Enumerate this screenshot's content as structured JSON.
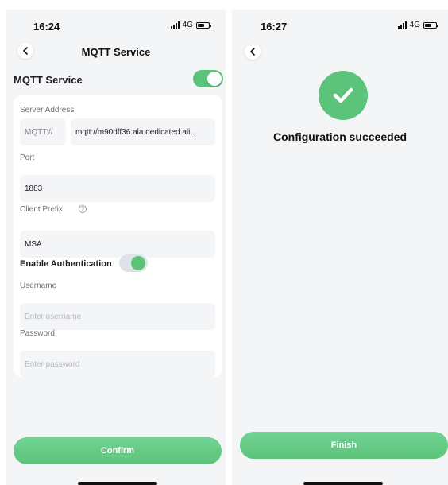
{
  "left": {
    "status": {
      "time": "16:24",
      "network": "4G"
    },
    "nav_title": "MQTT Service",
    "section_title": "MQTT Service",
    "main_toggle_on": true,
    "form": {
      "server_address_label": "Server Address",
      "protocol_prefix": "MQTT://",
      "server_host": "mqtt://m90dff36.ala.dedicated.ali...",
      "port_label": "Port",
      "port_value": "1883",
      "client_prefix_label": "Client Prefix",
      "client_prefix_help_icon": "?",
      "client_prefix_value": "MSA",
      "auth_label": "Enable Authentication",
      "auth_toggle_on": true,
      "username_label": "Username",
      "username_placeholder": "Enter username",
      "password_label": "Password",
      "password_placeholder": "Enter password"
    },
    "confirm_label": "Confirm"
  },
  "right": {
    "status": {
      "time": "16:27",
      "network": "4G"
    },
    "success_message": "Configuration succeeded",
    "finish_label": "Finish"
  },
  "colors": {
    "accent": "#5cc37a",
    "background": "#f4f5f7",
    "card": "#ffffff",
    "field": "#f4f5f7"
  },
  "icons": [
    "back-chevron-icon",
    "signal-icon",
    "battery-icon",
    "help-circle-icon",
    "checkmark-icon"
  ]
}
